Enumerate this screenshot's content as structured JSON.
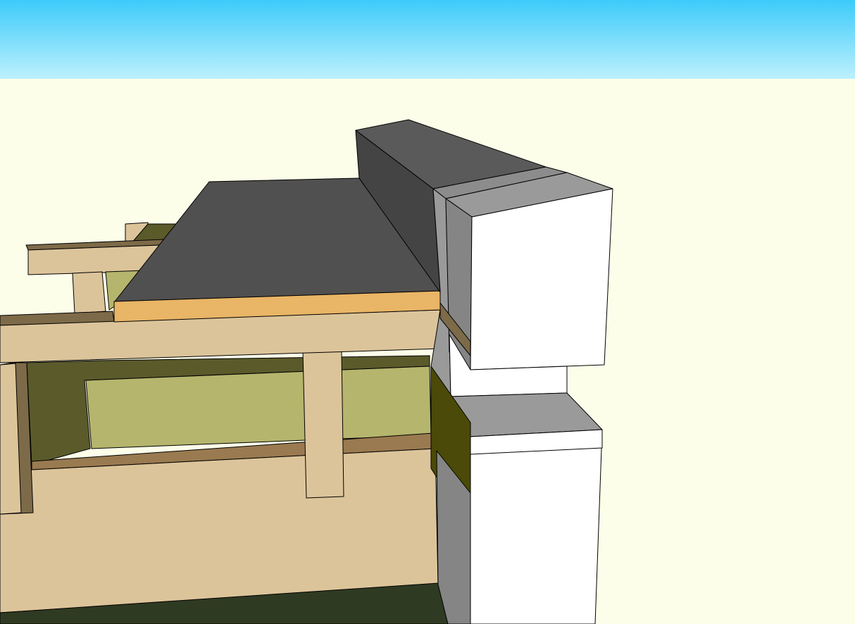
{
  "viewport": {
    "sky_top": "#3ccbfa",
    "sky_bottom": "#bdf0fd",
    "ground": "#fdfee9"
  },
  "materials": {
    "roof_dark": "#505050",
    "block_dark_side": "#444444",
    "block_dark_top": "#5a5a5a",
    "gray_mid": "#8c8c8c",
    "gray_light": "#9a9a9a",
    "gray_side": "#858585",
    "white": "#ffffff",
    "wood": "#dcc49a",
    "wood_dark": "#9a7a50",
    "wood_shadow": "#7d6a48",
    "insulation_strip": "#e9b566",
    "insulation_green": "#b5b56d",
    "olive_shadow": "#5b5a2b",
    "olive_wall": "#4b4a08",
    "dark_green": "#2f3a22"
  }
}
